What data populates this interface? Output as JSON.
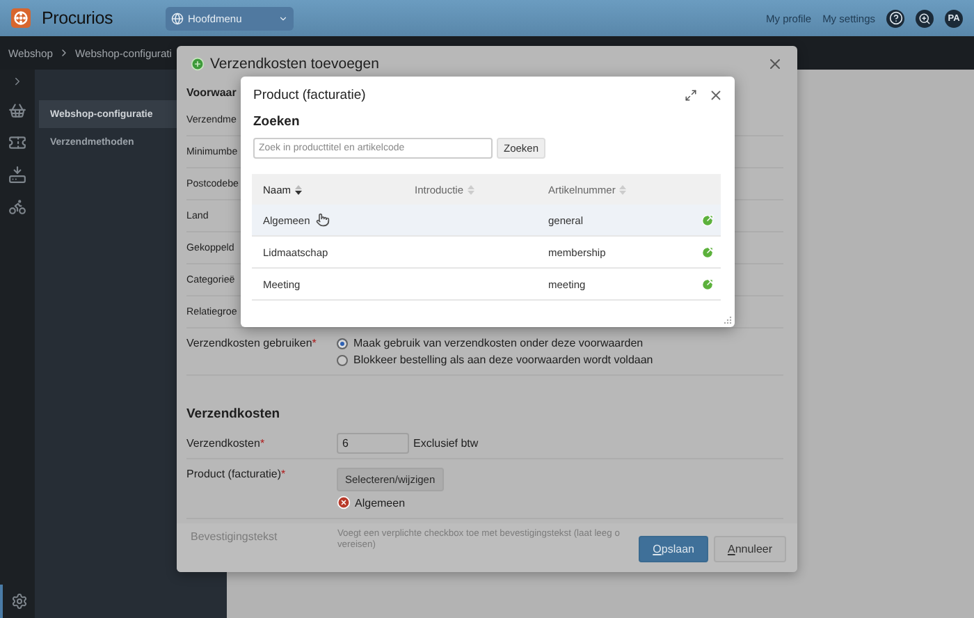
{
  "top_bar": {
    "brand": "Procurios",
    "main_menu": "Hoofdmenu",
    "links": [
      "My profile",
      "My settings"
    ],
    "avatar": "PA"
  },
  "breadcrumb": [
    "Webshop",
    "Webshop-configurati"
  ],
  "sidebar": {
    "items": [
      {
        "label": "Webshop-configuratie",
        "selected": true
      },
      {
        "label": "Verzendmethoden",
        "selected": false
      }
    ]
  },
  "dialog": {
    "title": "Verzendkosten toevoegen",
    "required_mark": "*",
    "sections": [
      {
        "heading": "Voorwaar",
        "rows": [
          {
            "kind": "plain",
            "label": "Verzendme",
            "required": false
          },
          {
            "kind": "plain",
            "label": "Minimumbe",
            "required": false
          },
          {
            "kind": "plain",
            "label": "Postcodebe",
            "required": false
          },
          {
            "kind": "plain",
            "label": "Land",
            "required": false
          },
          {
            "kind": "plain",
            "label": "Gekoppeld",
            "required": false
          },
          {
            "kind": "plain",
            "label": "Categorieë",
            "required": false
          },
          {
            "kind": "plain",
            "label": "Relatiegroe",
            "required": false
          },
          {
            "kind": "radio",
            "label": "Verzendkosten gebruiken",
            "required": true,
            "options": [
              {
                "label": "Maak gebruik van verzendkosten onder deze voorwaarden",
                "selected": true
              },
              {
                "label": "Blokkeer bestelling als aan deze voorwaarden wordt voldaan",
                "selected": false
              }
            ]
          }
        ]
      },
      {
        "heading": "Verzendkosten",
        "rows": [
          {
            "kind": "input",
            "label": "Verzendkosten",
            "required": true,
            "value": "6",
            "suffix": "Exclusief btw"
          },
          {
            "kind": "picker",
            "label": "Product (facturatie)",
            "required": true,
            "button": "Selecteren/wijzigen",
            "chosen": "Algemeen"
          }
        ]
      }
    ],
    "footer": {
      "label": "Bevestigingstekst",
      "hint_lines": [
        "Voegt een verplichte checkbox toe met bevestigingstekst (laat leeg o",
        "vereisen)"
      ],
      "buttons": [
        {
          "label": "Opslaan",
          "primary": true
        },
        {
          "label": "Annuleer",
          "primary": false
        }
      ]
    }
  },
  "product_picker": {
    "title": "Product (facturatie)",
    "search_heading": "Zoeken",
    "search": {
      "placeholder": "Zoek in producttitel en artikelcode"
    },
    "search_button": "Zoeken",
    "columns": [
      {
        "label": "Naam",
        "sorted": true
      },
      {
        "label": "Introductie",
        "sorted": false
      },
      {
        "label": "Artikelnummer",
        "sorted": false
      }
    ],
    "rows": [
      {
        "name": "Algemeen",
        "code": "general",
        "highlighted": true
      },
      {
        "name": "Lidmaatschap",
        "code": "membership",
        "highlighted": false
      },
      {
        "name": "Meeting",
        "code": "meeting",
        "highlighted": false
      }
    ]
  }
}
